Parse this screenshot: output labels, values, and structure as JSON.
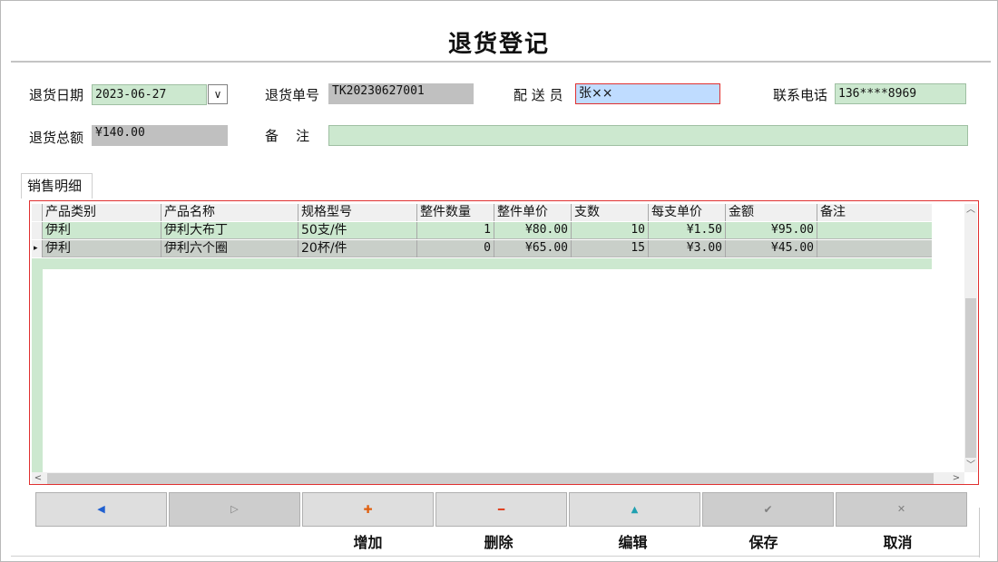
{
  "title": "退货登记",
  "form": {
    "return_date_label": "退货日期",
    "return_date_value": "2023-06-27",
    "return_no_label": "退货单号",
    "return_no_value": "TK20230627001",
    "courier_label": "配 送 员",
    "courier_value": "张××",
    "phone_label": "联系电话",
    "phone_value": "136****8969",
    "total_label": "退货总额",
    "total_value": "¥140.00",
    "remark_label": "备    注",
    "remark_value": ""
  },
  "tab": {
    "label": "销售明细"
  },
  "grid": {
    "columns": [
      "产品类别",
      "产品名称",
      "规格型号",
      "整件数量",
      "整件单价",
      "支数",
      "每支单价",
      "金额",
      "备注"
    ],
    "rows": [
      [
        "伊利",
        "伊利大布丁",
        "50支/件",
        "1",
        "¥80.00",
        "10",
        "¥1.50",
        "¥95.00",
        ""
      ],
      [
        "伊利",
        "伊利六个圈",
        "20杯/件",
        "0",
        "¥65.00",
        "15",
        "¥3.00",
        "¥45.00",
        ""
      ]
    ],
    "current_row_marker": "▸"
  },
  "toolbar": {
    "prev_icon": "◀",
    "next_icon": "▷",
    "add_icon": "✚",
    "delete_icon": "━",
    "edit_icon": "▲",
    "save_icon": "✔",
    "cancel_icon": "✕",
    "add_label": "增加",
    "delete_label": "删除",
    "edit_label": "编辑",
    "save_label": "保存",
    "cancel_label": "取消"
  },
  "colors": {
    "field_green": "#cce8cf",
    "field_gray": "#c0c0c0",
    "field_blue": "#bfdcff",
    "grid_border": "#e03030",
    "add_icon": "#e06010",
    "delete_icon": "#e04020",
    "edit_icon": "#20a0b0",
    "prev_icon": "#2060d0"
  }
}
